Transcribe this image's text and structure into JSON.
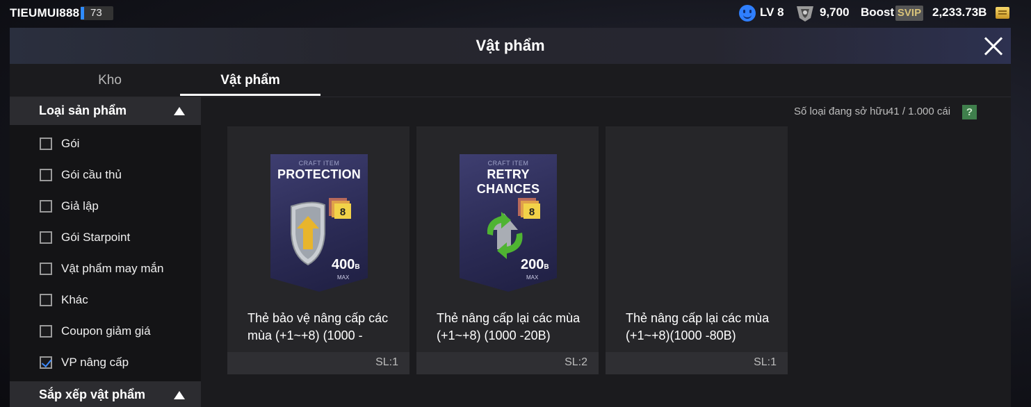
{
  "topbar": {
    "username": "TIEUMUI888",
    "level_num": "73",
    "lv": "LV 8",
    "points": "9,700",
    "boost_label": "Boost",
    "svip_label": "SVIP",
    "balance": "2,233.73B"
  },
  "window": {
    "title": "Vật phẩm"
  },
  "tabs": {
    "kho": "Kho",
    "vat_pham": "Vật phẩm"
  },
  "sidebar": {
    "section_type": "Loại sản phẩm",
    "filters": [
      {
        "label": "Gói",
        "checked": false
      },
      {
        "label": "Gói cầu thủ",
        "checked": false
      },
      {
        "label": "Giả lập",
        "checked": false
      },
      {
        "label": "Gói Starpoint",
        "checked": false
      },
      {
        "label": "Vật phẩm may mắn",
        "checked": false
      },
      {
        "label": "Khác",
        "checked": false
      },
      {
        "label": "Coupon giảm giá",
        "checked": false
      },
      {
        "label": "VP nâng cấp",
        "checked": true
      }
    ],
    "section_sort": "Sắp xếp vật phẩm"
  },
  "owned": {
    "label": "Số loại đang sở hữu",
    "value": "41 / 1.000 cái",
    "help": "?"
  },
  "cards": [
    {
      "pack_sub": "CRAFT ITEM",
      "pack_title": "PROTECTION",
      "pack_price": "400",
      "pack_unit": "B",
      "pack_max": "MAX",
      "badge": "8",
      "name": "Thẻ bảo vệ nâng cấp các mùa (+1~+8) (1000 -",
      "qty": "SL:1"
    },
    {
      "pack_sub": "CRAFT ITEM",
      "pack_title": "RETRY CHANCES",
      "pack_price": "200",
      "pack_unit": "B",
      "pack_max": "MAX",
      "badge": "8",
      "name": "Thẻ nâng cấp lại các mùa (+1~+8) (1000 -20B)",
      "qty": "SL:2"
    },
    {
      "name": "Thẻ nâng cấp lại các mùa (+1~+8)(1000 -80B)",
      "qty": "SL:1"
    }
  ]
}
